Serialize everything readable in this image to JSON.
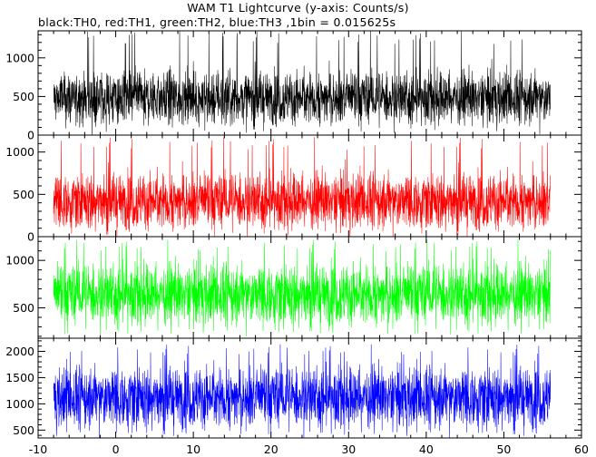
{
  "chart_data": {
    "type": "line",
    "title": "WAM T1 Lightcurve (y-axis: Counts/s)",
    "subtitle": "black:TH0, red:TH1, green:TH2, blue:TH3 ,1bin = 0.015625s",
    "x_range": [
      -10,
      60
    ],
    "x_ticks": [
      "-10",
      "0",
      "10",
      "20",
      "30",
      "40",
      "50",
      "60"
    ],
    "x_tick_values": [
      -10,
      0,
      10,
      20,
      30,
      40,
      50,
      60
    ],
    "data_x_range": [
      -8,
      56
    ],
    "panels": [
      {
        "series": "TH0",
        "color": "#000000",
        "ylim": [
          0,
          1350
        ],
        "yticks": [
          0,
          500,
          1000
        ],
        "ytick_labels": [
          "0",
          "500",
          "1000"
        ],
        "mean": 480,
        "noise": 170,
        "spike_max": 1350,
        "spike_min": 110
      },
      {
        "series": "TH1",
        "color": "#ff0000",
        "ylim": [
          0,
          1200
        ],
        "yticks": [
          0,
          500,
          1000
        ],
        "ytick_labels": [
          "0",
          "500",
          "1000"
        ],
        "mean": 420,
        "noise": 165,
        "spike_max": 1180,
        "spike_min": 80
      },
      {
        "series": "TH2",
        "color": "#00ff00",
        "ylim": [
          180,
          1250
        ],
        "yticks": [
          500,
          1000
        ],
        "ytick_labels": [
          "500",
          "1000"
        ],
        "mean": 640,
        "noise": 160,
        "spike_max": 1220,
        "spike_min": 220
      },
      {
        "series": "TH3",
        "color": "#0000ff",
        "ylim": [
          350,
          2250
        ],
        "yticks": [
          500,
          1000,
          1500,
          2000
        ],
        "ytick_labels": [
          "500",
          "1000",
          "1500",
          "2000"
        ],
        "mean": 1120,
        "noise": 290,
        "spike_max": 2140,
        "spike_min": 420
      }
    ]
  }
}
